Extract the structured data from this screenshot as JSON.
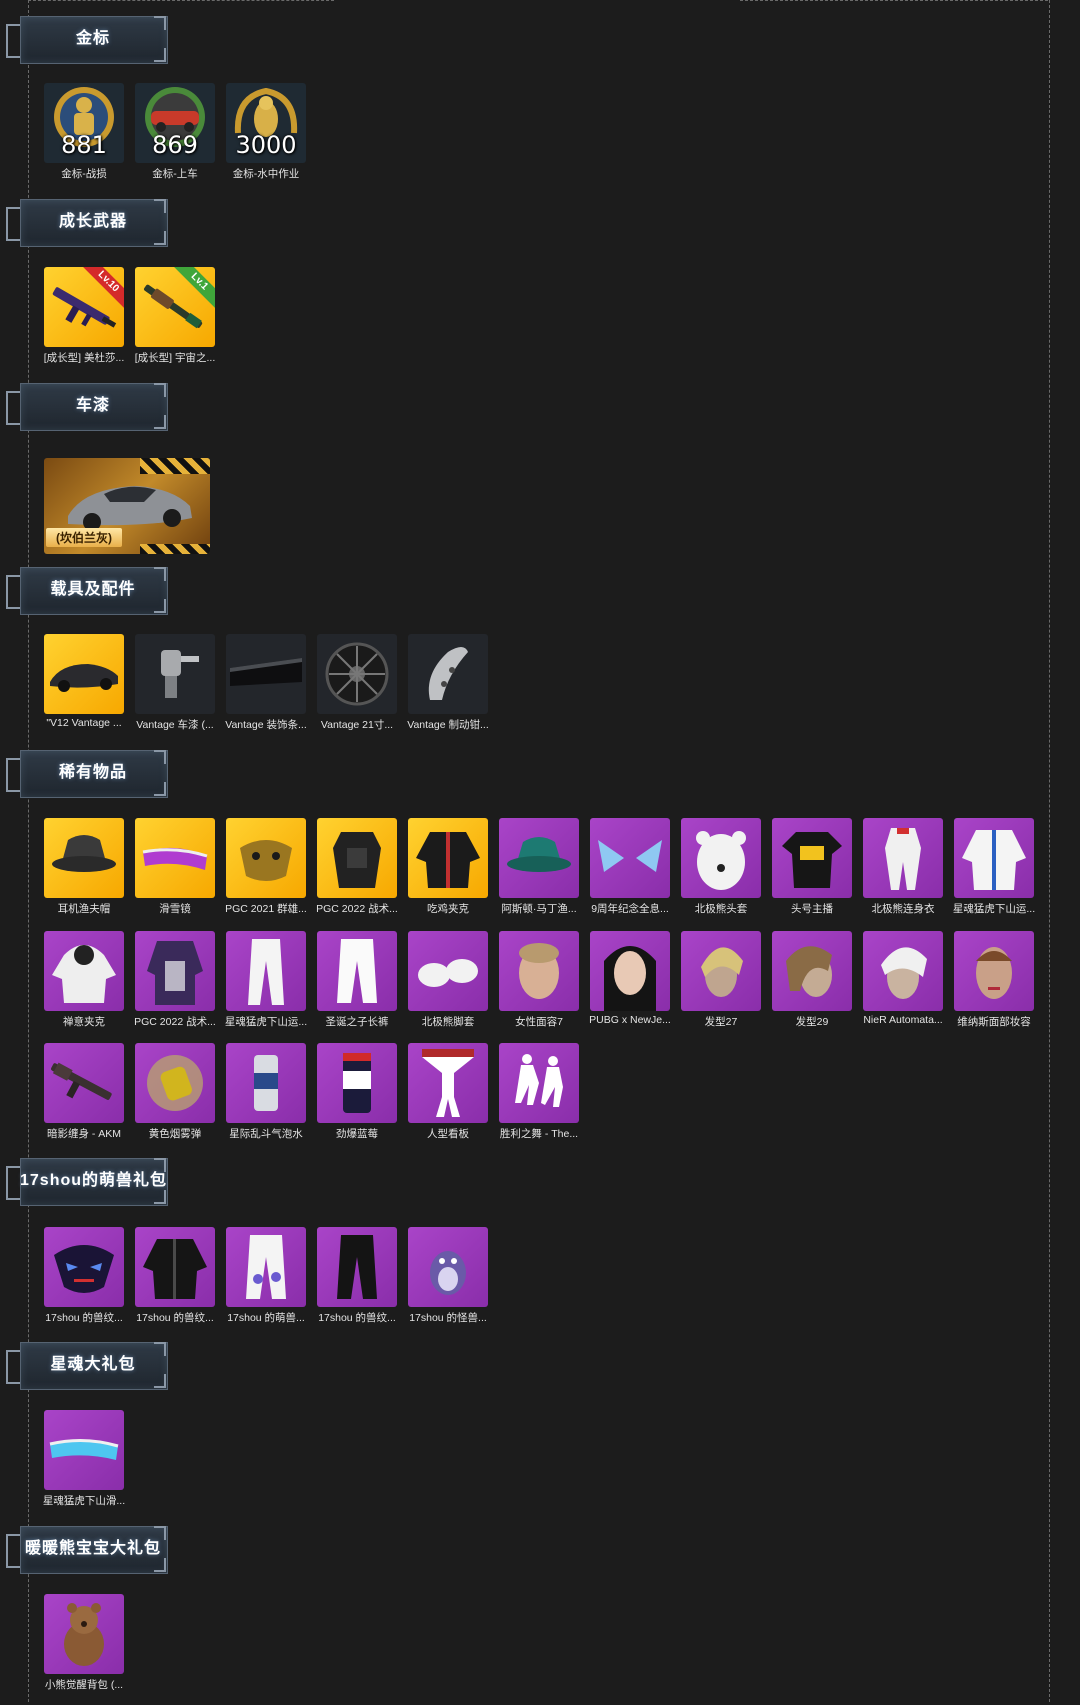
{
  "sections": [
    {
      "title": "金标",
      "items": [
        {
          "caption": "金标-战损",
          "badge": "881",
          "icon": "soldier-medal-icon"
        },
        {
          "caption": "金标-上车",
          "badge": "869",
          "icon": "car-medal-icon"
        },
        {
          "caption": "金标-水中作业",
          "badge": "3000",
          "icon": "seal-medal-icon"
        }
      ]
    },
    {
      "title": "成长武器",
      "items": [
        {
          "caption": "[成长型] 美杜莎...",
          "level": "Lv.10",
          "icon": "rifle-icon"
        },
        {
          "caption": "[成长型] 宇宙之...",
          "level": "Lv.1",
          "icon": "shotgun-icon"
        }
      ]
    },
    {
      "title": "车漆",
      "items": [
        {
          "label": "(坎伯兰灰)",
          "icon": "sports-car-icon"
        }
      ]
    },
    {
      "title": "载具及配件",
      "items": [
        {
          "caption": "\"V12 Vantage ...",
          "icon": "sports-car-icon"
        },
        {
          "caption": "Vantage 车漆 (...",
          "icon": "paint-sprayer-icon"
        },
        {
          "caption": "Vantage 装饰条...",
          "icon": "trim-strip-icon"
        },
        {
          "caption": "Vantage 21寸...",
          "icon": "wheel-icon"
        },
        {
          "caption": "Vantage 制动钳...",
          "icon": "brake-caliper-icon"
        }
      ]
    },
    {
      "title": "稀有物品",
      "items": [
        {
          "caption": "耳机渔夫帽",
          "icon": "bucket-hat-icon"
        },
        {
          "caption": "滑雪镜",
          "icon": "ski-goggles-icon"
        },
        {
          "caption": "PGC 2021 群雄...",
          "icon": "gold-mask-icon"
        },
        {
          "caption": "PGC 2022 战术...",
          "icon": "tactical-vest-icon"
        },
        {
          "caption": "吃鸡夹克",
          "icon": "jacket-icon"
        },
        {
          "caption": "阿斯顿·马丁渔...",
          "icon": "bucket-hat-icon"
        },
        {
          "caption": "9周年纪念全息...",
          "icon": "cat-ears-icon"
        },
        {
          "caption": "北极熊头套",
          "icon": "polar-bear-mask-icon"
        },
        {
          "caption": "头号主播",
          "icon": "tshirt-icon"
        },
        {
          "caption": "北极熊连身衣",
          "icon": "jumpsuit-icon"
        },
        {
          "caption": "星魂猛虎下山运...",
          "icon": "track-jacket-icon"
        },
        {
          "caption": "禅意夹克",
          "icon": "hooded-jacket-icon"
        },
        {
          "caption": "PGC 2022 战术...",
          "icon": "coat-icon"
        },
        {
          "caption": "星魂猛虎下山运...",
          "icon": "track-pants-icon"
        },
        {
          "caption": "圣诞之子长裤",
          "icon": "white-pants-icon"
        },
        {
          "caption": "北极熊脚套",
          "icon": "paw-shoes-icon"
        },
        {
          "caption": "女性面容7",
          "icon": "female-face-icon"
        },
        {
          "caption": "PUBG x NewJe...",
          "icon": "female-face-icon"
        },
        {
          "caption": "发型27",
          "icon": "hairstyle-icon"
        },
        {
          "caption": "发型29",
          "icon": "hairstyle-icon"
        },
        {
          "caption": "NieR Automata...",
          "icon": "white-hair-icon"
        },
        {
          "caption": "维纳斯面部妆容",
          "icon": "makeup-face-icon"
        },
        {
          "caption": "暗影缠身 - AKM",
          "icon": "rifle-icon"
        },
        {
          "caption": "黄色烟雾弹",
          "icon": "smoke-grenade-icon"
        },
        {
          "caption": "星际乱斗气泡水",
          "icon": "soda-can-icon"
        },
        {
          "caption": "劲爆蓝莓",
          "icon": "energy-can-icon"
        },
        {
          "caption": "人型看板",
          "icon": "figure-sign-icon"
        },
        {
          "caption": "胜利之舞 - The...",
          "icon": "dance-emote-icon"
        }
      ]
    },
    {
      "title": "17shou的萌兽礼包",
      "items": [
        {
          "caption": "17shou 的兽纹...",
          "icon": "beast-mask-icon"
        },
        {
          "caption": "17shou 的兽纹...",
          "icon": "jacket-icon"
        },
        {
          "caption": "17shou 的萌兽...",
          "icon": "white-pants-icon"
        },
        {
          "caption": "17shou 的兽纹...",
          "icon": "black-pants-icon"
        },
        {
          "caption": "17shou 的怪兽...",
          "icon": "monster-pet-icon"
        }
      ]
    },
    {
      "title": "星魂大礼包",
      "items": [
        {
          "caption": "星魂猛虎下山滑...",
          "icon": "ski-goggles-icon"
        }
      ]
    },
    {
      "title": "暖暖熊宝宝大礼包",
      "items": [
        {
          "caption": "小熊觉醒背包 (...",
          "icon": "teddy-backpack-icon"
        }
      ]
    }
  ],
  "colors": {
    "gold_tile": "#f7b500",
    "purple_tile": "#9b3bbd",
    "background": "#1c1c1c"
  }
}
